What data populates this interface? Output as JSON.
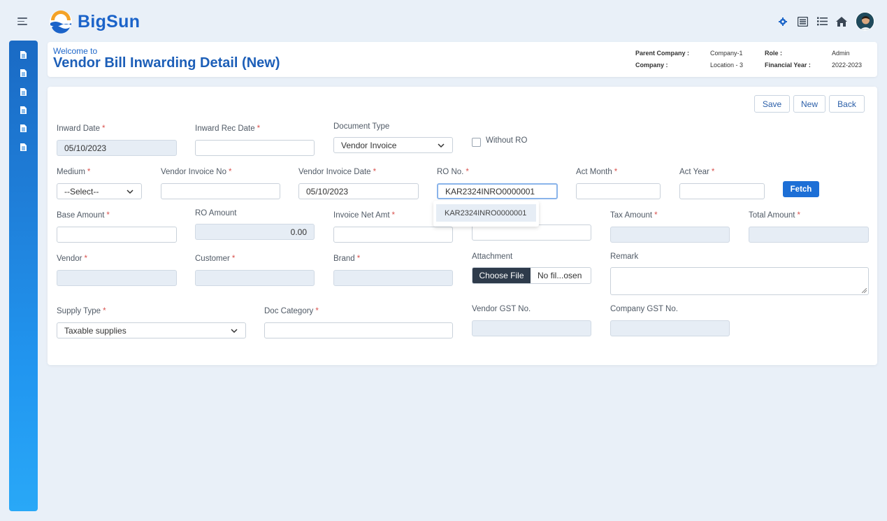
{
  "brand": {
    "name": "BigSun"
  },
  "header": {
    "welcome": "Welcome to",
    "title": "Vendor Bill Inwarding Detail (New)",
    "parent_company_label": "Parent Company :",
    "parent_company_value": "Company-1",
    "company_label": "Company :",
    "company_value": "Location - 3",
    "role_label": "Role :",
    "role_value": "Admin",
    "fy_label": "Financial Year :",
    "fy_value": "2022-2023"
  },
  "top_icons": [
    "gear-icon",
    "list-alt-icon",
    "list-icon",
    "home-icon",
    "avatar"
  ],
  "sidebar": {
    "icons": [
      "document-icon",
      "document-icon",
      "document-icon",
      "document-icon",
      "document-icon",
      "document-icon"
    ]
  },
  "actions": {
    "save": "Save",
    "new": "New",
    "back": "Back"
  },
  "form": {
    "inward_date": {
      "label": "Inward Date",
      "value": "05/10/2023"
    },
    "inward_rec_date": {
      "label": "Inward Rec Date",
      "value": ""
    },
    "document_type": {
      "label": "Document Type",
      "value": "Vendor Invoice"
    },
    "without_ro": {
      "label": "Without RO",
      "checked": false
    },
    "medium": {
      "label": "Medium",
      "value": "--Select--"
    },
    "vendor_invoice_no": {
      "label": "Vendor Invoice No",
      "value": ""
    },
    "vendor_invoice_date": {
      "label": "Vendor Invoice Date",
      "value": "05/10/2023"
    },
    "ro_no": {
      "label": "RO No.",
      "value": "KAR2324INRO0000001",
      "suggestion": "KAR2324INRO0000001"
    },
    "act_month": {
      "label": "Act Month",
      "value": ""
    },
    "act_year": {
      "label": "Act Year",
      "value": ""
    },
    "fetch": "Fetch",
    "base_amount": {
      "label": "Base Amount",
      "value": ""
    },
    "ro_amount": {
      "label": "RO Amount",
      "value": "0.00"
    },
    "invoice_net_amt": {
      "label": "Invoice Net Amt",
      "value": ""
    },
    "tax_amount": {
      "label": "Tax Amount",
      "value": ""
    },
    "total_amount": {
      "label": "Total Amount",
      "value": ""
    },
    "vendor": {
      "label": "Vendor",
      "value": ""
    },
    "customer": {
      "label": "Customer",
      "value": ""
    },
    "brand": {
      "label": "Brand",
      "value": ""
    },
    "attachment": {
      "label": "Attachment",
      "button": "Choose File",
      "file_name": "No fil...osen"
    },
    "remark": {
      "label": "Remark",
      "value": ""
    },
    "supply_type": {
      "label": "Supply Type",
      "value": "Taxable supplies"
    },
    "doc_category": {
      "label": "Doc Category",
      "value": ""
    },
    "vendor_gst": {
      "label": "Vendor GST No.",
      "value": ""
    },
    "company_gst": {
      "label": "Company GST No.",
      "value": ""
    }
  },
  "required_marker": "*",
  "colors": {
    "accent": "#1d6fd6",
    "title": "#1d5fb8",
    "required": "#d9534f",
    "sidebar_top": "#1a6ac4",
    "sidebar_bottom": "#29a8f7"
  }
}
